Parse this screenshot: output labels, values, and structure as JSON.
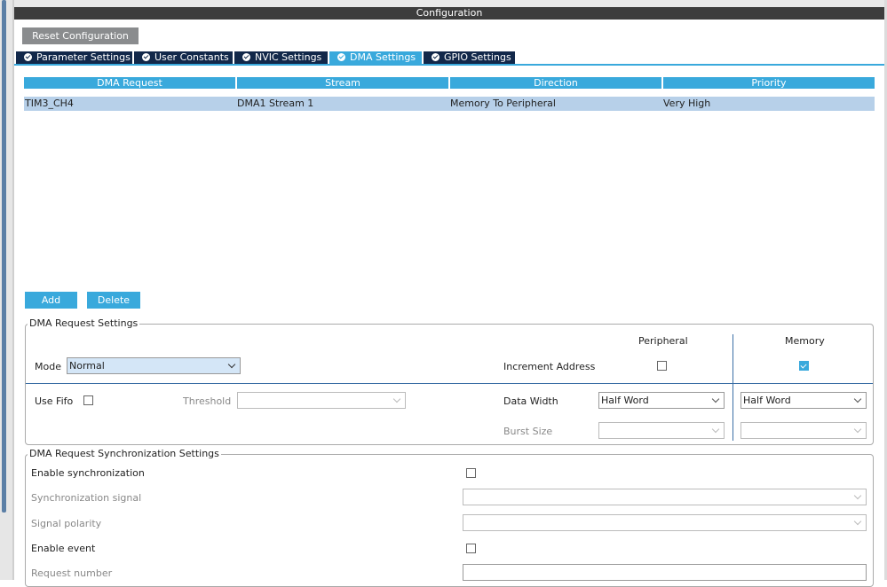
{
  "window": {
    "title": "Configuration"
  },
  "toolbar": {
    "reset_label": "Reset Configuration"
  },
  "tabs": [
    {
      "label": "Parameter Settings",
      "active": false
    },
    {
      "label": "User Constants",
      "active": false
    },
    {
      "label": "NVIC Settings",
      "active": false
    },
    {
      "label": "DMA Settings",
      "active": true
    },
    {
      "label": "GPIO Settings",
      "active": false
    }
  ],
  "dma_table": {
    "headers": [
      "DMA Request",
      "Stream",
      "Direction",
      "Priority"
    ],
    "rows": [
      [
        "TIM3_CH4",
        "DMA1 Stream 1",
        "Memory To Peripheral",
        "Very High"
      ]
    ]
  },
  "actions": {
    "add_label": "Add",
    "delete_label": "Delete"
  },
  "request_settings": {
    "legend": "DMA Request Settings",
    "peripheral_header": "Peripheral",
    "memory_header": "Memory",
    "mode_label": "Mode",
    "mode_value": "Normal",
    "increment_label": "Increment Address",
    "increment_peripheral": false,
    "increment_memory": true,
    "use_fifo_label": "Use Fifo",
    "use_fifo": false,
    "threshold_label": "Threshold",
    "threshold_value": "",
    "data_width_label": "Data Width",
    "data_width_peripheral": "Half Word",
    "data_width_memory": "Half Word",
    "burst_size_label": "Burst Size",
    "burst_peripheral": "",
    "burst_memory": ""
  },
  "sync_settings": {
    "legend": "DMA Request Synchronization Settings",
    "enable_sync_label": "Enable synchronization",
    "enable_sync": false,
    "sync_signal_label": "Synchronization signal",
    "sync_signal_value": "",
    "signal_polarity_label": "Signal polarity",
    "signal_polarity_value": "",
    "enable_event_label": "Enable event",
    "enable_event": false,
    "request_number_label": "Request number",
    "request_number_value": ""
  },
  "colors": {
    "accent": "#39a9dc",
    "tab_inactive": "#12284a",
    "title_bar": "#3d3d3d",
    "row_selected": "#b7d0e9",
    "reset_button": "#8a8c8e"
  }
}
